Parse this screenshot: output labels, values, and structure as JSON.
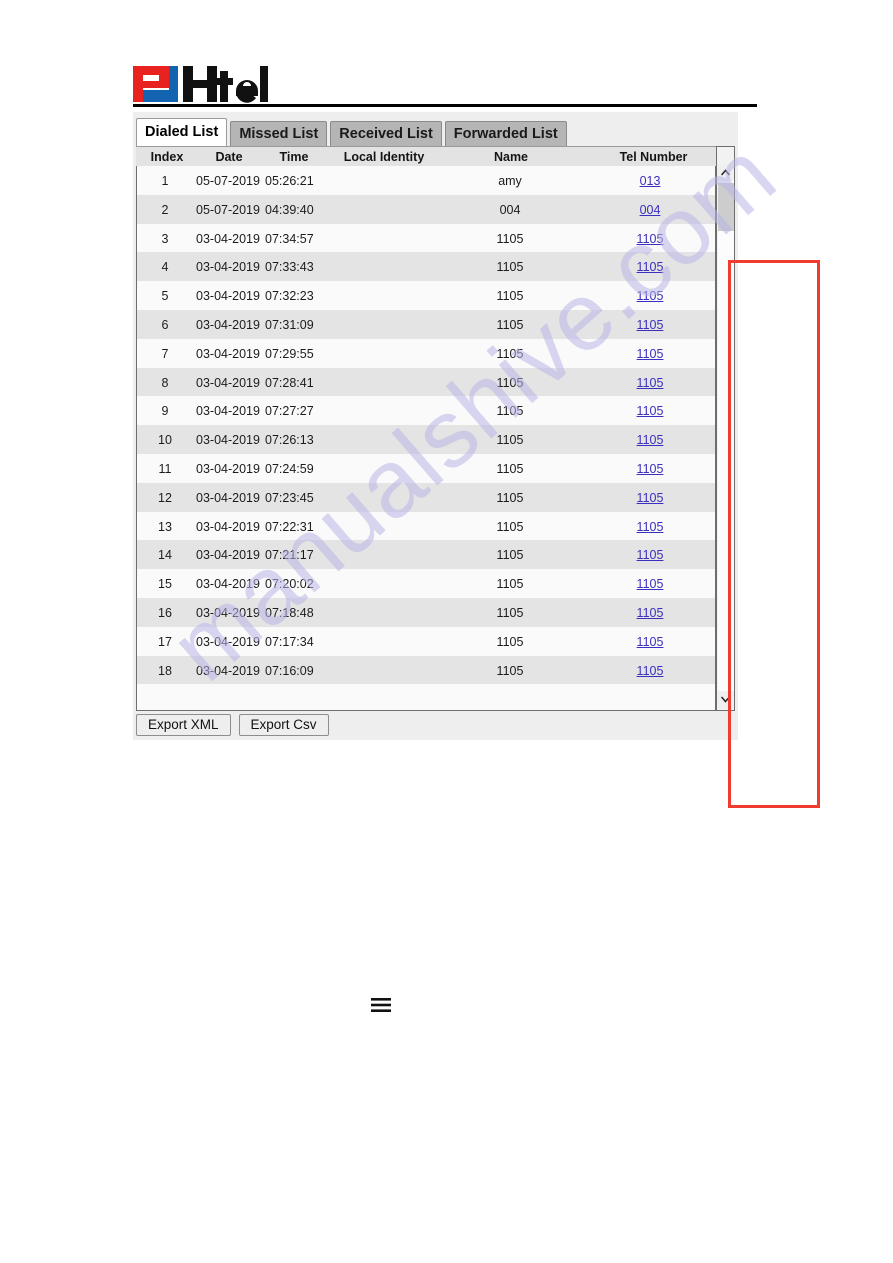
{
  "brand": {
    "logo_text": "Htek",
    "logo_icon": "htek-logo-icon",
    "accent_red": "#e8231f",
    "accent_blue": "#1263b0"
  },
  "tabs": [
    {
      "label": "Dialed List",
      "active": true
    },
    {
      "label": "Missed List",
      "active": false
    },
    {
      "label": "Received List",
      "active": false
    },
    {
      "label": "Forwarded List",
      "active": false
    }
  ],
  "table": {
    "columns": [
      "Index",
      "Date",
      "Time",
      "Local Identity",
      "Name",
      "Tel Number"
    ],
    "highlight_color": "#ef3b30",
    "link_color": "#3b2fbf",
    "rows": [
      {
        "index": "1",
        "date": "05-07-2019",
        "time": "05:26:21",
        "local_identity": "",
        "name": "amy",
        "tel": "013"
      },
      {
        "index": "2",
        "date": "05-07-2019",
        "time": "04:39:40",
        "local_identity": "",
        "name": "004",
        "tel": "004"
      },
      {
        "index": "3",
        "date": "03-04-2019",
        "time": "07:34:57",
        "local_identity": "",
        "name": "1105",
        "tel": "1105"
      },
      {
        "index": "4",
        "date": "03-04-2019",
        "time": "07:33:43",
        "local_identity": "",
        "name": "1105",
        "tel": "1105"
      },
      {
        "index": "5",
        "date": "03-04-2019",
        "time": "07:32:23",
        "local_identity": "",
        "name": "1105",
        "tel": "1105"
      },
      {
        "index": "6",
        "date": "03-04-2019",
        "time": "07:31:09",
        "local_identity": "",
        "name": "1105",
        "tel": "1105"
      },
      {
        "index": "7",
        "date": "03-04-2019",
        "time": "07:29:55",
        "local_identity": "",
        "name": "1105",
        "tel": "1105"
      },
      {
        "index": "8",
        "date": "03-04-2019",
        "time": "07:28:41",
        "local_identity": "",
        "name": "1105",
        "tel": "1105"
      },
      {
        "index": "9",
        "date": "03-04-2019",
        "time": "07:27:27",
        "local_identity": "",
        "name": "1105",
        "tel": "1105"
      },
      {
        "index": "10",
        "date": "03-04-2019",
        "time": "07:26:13",
        "local_identity": "",
        "name": "1105",
        "tel": "1105"
      },
      {
        "index": "11",
        "date": "03-04-2019",
        "time": "07:24:59",
        "local_identity": "",
        "name": "1105",
        "tel": "1105"
      },
      {
        "index": "12",
        "date": "03-04-2019",
        "time": "07:23:45",
        "local_identity": "",
        "name": "1105",
        "tel": "1105"
      },
      {
        "index": "13",
        "date": "03-04-2019",
        "time": "07:22:31",
        "local_identity": "",
        "name": "1105",
        "tel": "1105"
      },
      {
        "index": "14",
        "date": "03-04-2019",
        "time": "07:21:17",
        "local_identity": "",
        "name": "1105",
        "tel": "1105"
      },
      {
        "index": "15",
        "date": "03-04-2019",
        "time": "07:20:02",
        "local_identity": "",
        "name": "1105",
        "tel": "1105"
      },
      {
        "index": "16",
        "date": "03-04-2019",
        "time": "07:18:48",
        "local_identity": "",
        "name": "1105",
        "tel": "1105"
      },
      {
        "index": "17",
        "date": "03-04-2019",
        "time": "07:17:34",
        "local_identity": "",
        "name": "1105",
        "tel": "1105"
      },
      {
        "index": "18",
        "date": "03-04-2019",
        "time": "07:16:09",
        "local_identity": "",
        "name": "1105",
        "tel": "1105"
      }
    ]
  },
  "buttons": {
    "export_xml": "Export XML",
    "export_csv": "Export Csv"
  },
  "scrollbar": {
    "up_icon": "chevron-up-icon",
    "down_icon": "chevron-down-icon"
  },
  "page_menu": {
    "icon": "hamburger-menu-icon"
  },
  "watermark": {
    "text": "manualshive.com"
  }
}
